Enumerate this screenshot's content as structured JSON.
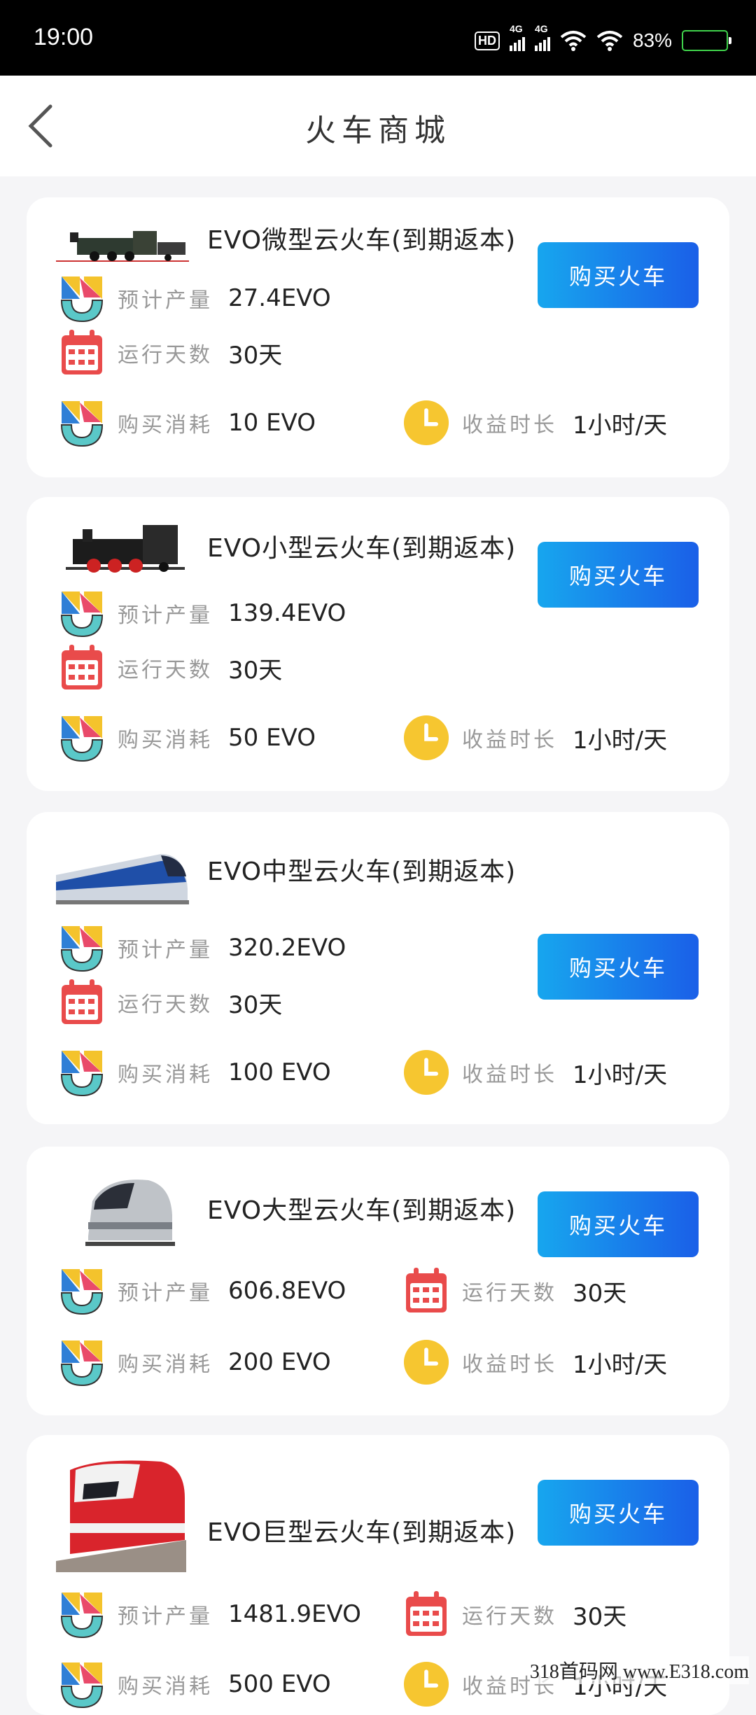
{
  "status_bar": {
    "time": "19:00",
    "hd": "HD",
    "net1": "4G",
    "net2": "4G",
    "battery": "83%",
    "battery_level": 0.83
  },
  "header": {
    "title": "火车商城"
  },
  "labels": {
    "output": "预计产量",
    "days": "运行天数",
    "cost": "购买消耗",
    "duration": "收益时长"
  },
  "buy_label": "购买火车",
  "cards": [
    {
      "name": "EVO微型云火车(到期返本)",
      "output": "27.4EVO",
      "days": "30天",
      "cost": "10 EVO",
      "duration": "1小时/天"
    },
    {
      "name": "EVO小型云火车(到期返本)",
      "output": "139.4EVO",
      "days": "30天",
      "cost": "50 EVO",
      "duration": "1小时/天"
    },
    {
      "name": "EVO中型云火车(到期返本)",
      "output": "320.2EVO",
      "days": "30天",
      "cost": "100 EVO",
      "duration": "1小时/天"
    },
    {
      "name": "EVO大型云火车(到期返本)",
      "output": "606.8EVO",
      "days": "30天",
      "cost": "200 EVO",
      "duration": "1小时/天"
    },
    {
      "name": "EVO巨型云火车(到期返本)",
      "output": "1481.9EVO",
      "days": "30天",
      "cost": "500 EVO",
      "duration": "1小时/天"
    }
  ],
  "watermark": "318首码网 www.E318.com"
}
